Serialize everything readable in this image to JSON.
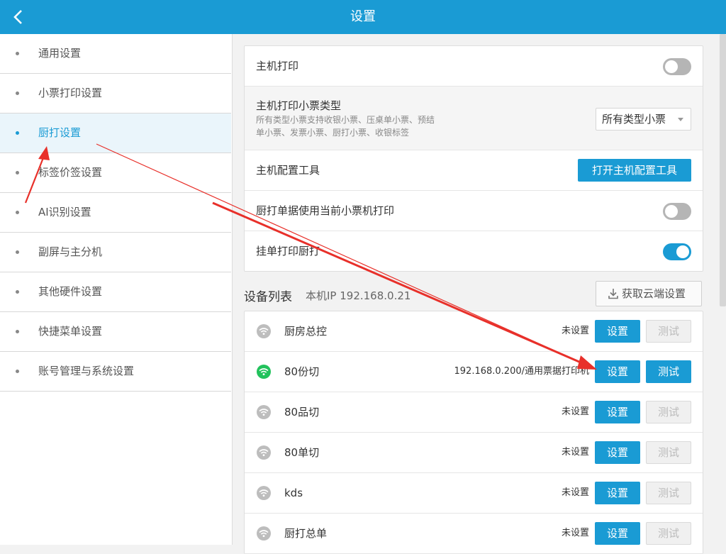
{
  "header": {
    "title": "设置"
  },
  "sidebar": {
    "items": [
      {
        "label": "通用设置",
        "active": false
      },
      {
        "label": "小票打印设置",
        "active": false
      },
      {
        "label": "厨打设置",
        "active": true
      },
      {
        "label": "标签价签设置",
        "active": false
      },
      {
        "label": "AI识别设置",
        "active": false
      },
      {
        "label": "副屏与主分机",
        "active": false
      },
      {
        "label": "其他硬件设置",
        "active": false
      },
      {
        "label": "快捷菜单设置",
        "active": false
      },
      {
        "label": "账号管理与系统设置",
        "active": false
      }
    ]
  },
  "settings": {
    "host_print": {
      "label": "主机打印",
      "enabled": false
    },
    "host_ticket_type": {
      "label": "主机打印小票类型",
      "description_line1": "所有类型小票支持收银小票、压桌单小票、预结",
      "description_line2": "单小票、发票小票、厨打小票、收银标签",
      "selected": "所有类型小票"
    },
    "host_config_tool": {
      "label": "主机配置工具",
      "button_label": "打开主机配置工具"
    },
    "kitchen_use_current": {
      "label": "厨打单据使用当前小票机打印",
      "enabled": false
    },
    "hang_order_print": {
      "label": "挂单打印厨打",
      "enabled": true
    }
  },
  "device_section": {
    "title": "设备列表",
    "ip_label": "本机IP 192.168.0.21",
    "cloud_button": "获取云端设置"
  },
  "devices": [
    {
      "name": "厨房总控",
      "status": "未设置",
      "online": false,
      "set_label": "设置",
      "test_label": "测试",
      "test_enabled": false
    },
    {
      "name": "80份切",
      "status": "192.168.0.200/通用票据打印机",
      "online": true,
      "set_label": "设置",
      "test_label": "测试",
      "test_enabled": true
    },
    {
      "name": "80品切",
      "status": "未设置",
      "online": false,
      "set_label": "设置",
      "test_label": "测试",
      "test_enabled": false
    },
    {
      "name": "80单切",
      "status": "未设置",
      "online": false,
      "set_label": "设置",
      "test_label": "测试",
      "test_enabled": false
    },
    {
      "name": "kds",
      "status": "未设置",
      "online": false,
      "set_label": "设置",
      "test_label": "测试",
      "test_enabled": false
    },
    {
      "name": "厨打总单",
      "status": "未设置",
      "online": false,
      "set_label": "设置",
      "test_label": "测试",
      "test_enabled": false
    }
  ],
  "colors": {
    "accent": "#1a9bd4",
    "online": "#22c25c",
    "annotation_arrow": "#e8302a"
  },
  "icons": {
    "back": "chevron-left-icon",
    "wifi": "wifi-icon",
    "download": "download-icon"
  }
}
